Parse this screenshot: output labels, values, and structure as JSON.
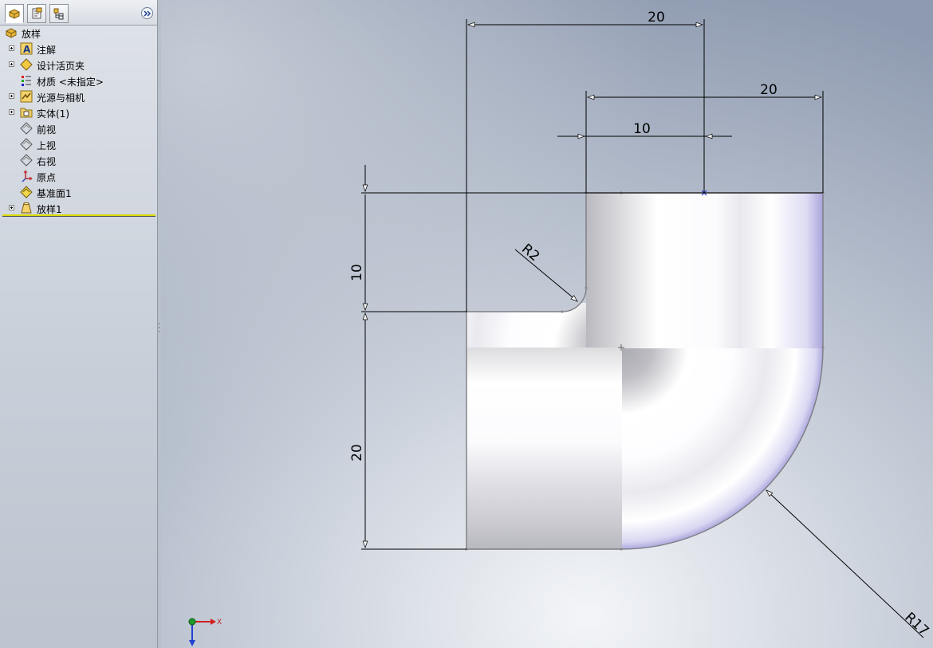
{
  "tree_tabs": [
    {
      "name": "feature-manager",
      "active": true
    },
    {
      "name": "property-manager",
      "active": false
    },
    {
      "name": "configuration-manager",
      "active": false
    }
  ],
  "tree": {
    "root": {
      "label": "放样",
      "icon": "loft-part-icon"
    },
    "items": [
      {
        "label": "注解",
        "icon": "annotations-icon",
        "expandable": true
      },
      {
        "label": "设计活页夹",
        "icon": "design-binder-icon",
        "expandable": true
      },
      {
        "label": "材质 <未指定>",
        "icon": "material-icon",
        "expandable": false
      },
      {
        "label": "光源与相机",
        "icon": "lights-cameras-icon",
        "expandable": true
      },
      {
        "label": "实体(1)",
        "icon": "solid-bodies-icon",
        "expandable": true
      },
      {
        "label": "前视",
        "icon": "plane-icon",
        "expandable": false
      },
      {
        "label": "上视",
        "icon": "plane-icon",
        "expandable": false
      },
      {
        "label": "右视",
        "icon": "plane-icon",
        "expandable": false
      },
      {
        "label": "原点",
        "icon": "origin-icon",
        "expandable": false
      },
      {
        "label": "基准面1",
        "icon": "plane-selected-icon",
        "expandable": false
      },
      {
        "label": "放样1",
        "icon": "loft-feature-icon",
        "expandable": true
      }
    ]
  },
  "dimensions": {
    "top_width": "20",
    "right_width": "20",
    "neck_width": "10",
    "left_upper_height": "10",
    "left_lower_height": "20",
    "inner_radius": "R2",
    "outer_radius": "R17"
  },
  "triad": {
    "x_label": "X"
  },
  "colors": {
    "panel_bg": "#d3d8e0",
    "viewport_bg": "#c4ccd8",
    "part_highlight": "#ffffff",
    "part_shadow": "#c7c7cc",
    "part_edge_tint": "#9a96d8",
    "rollback_bar": "#d8d800"
  }
}
